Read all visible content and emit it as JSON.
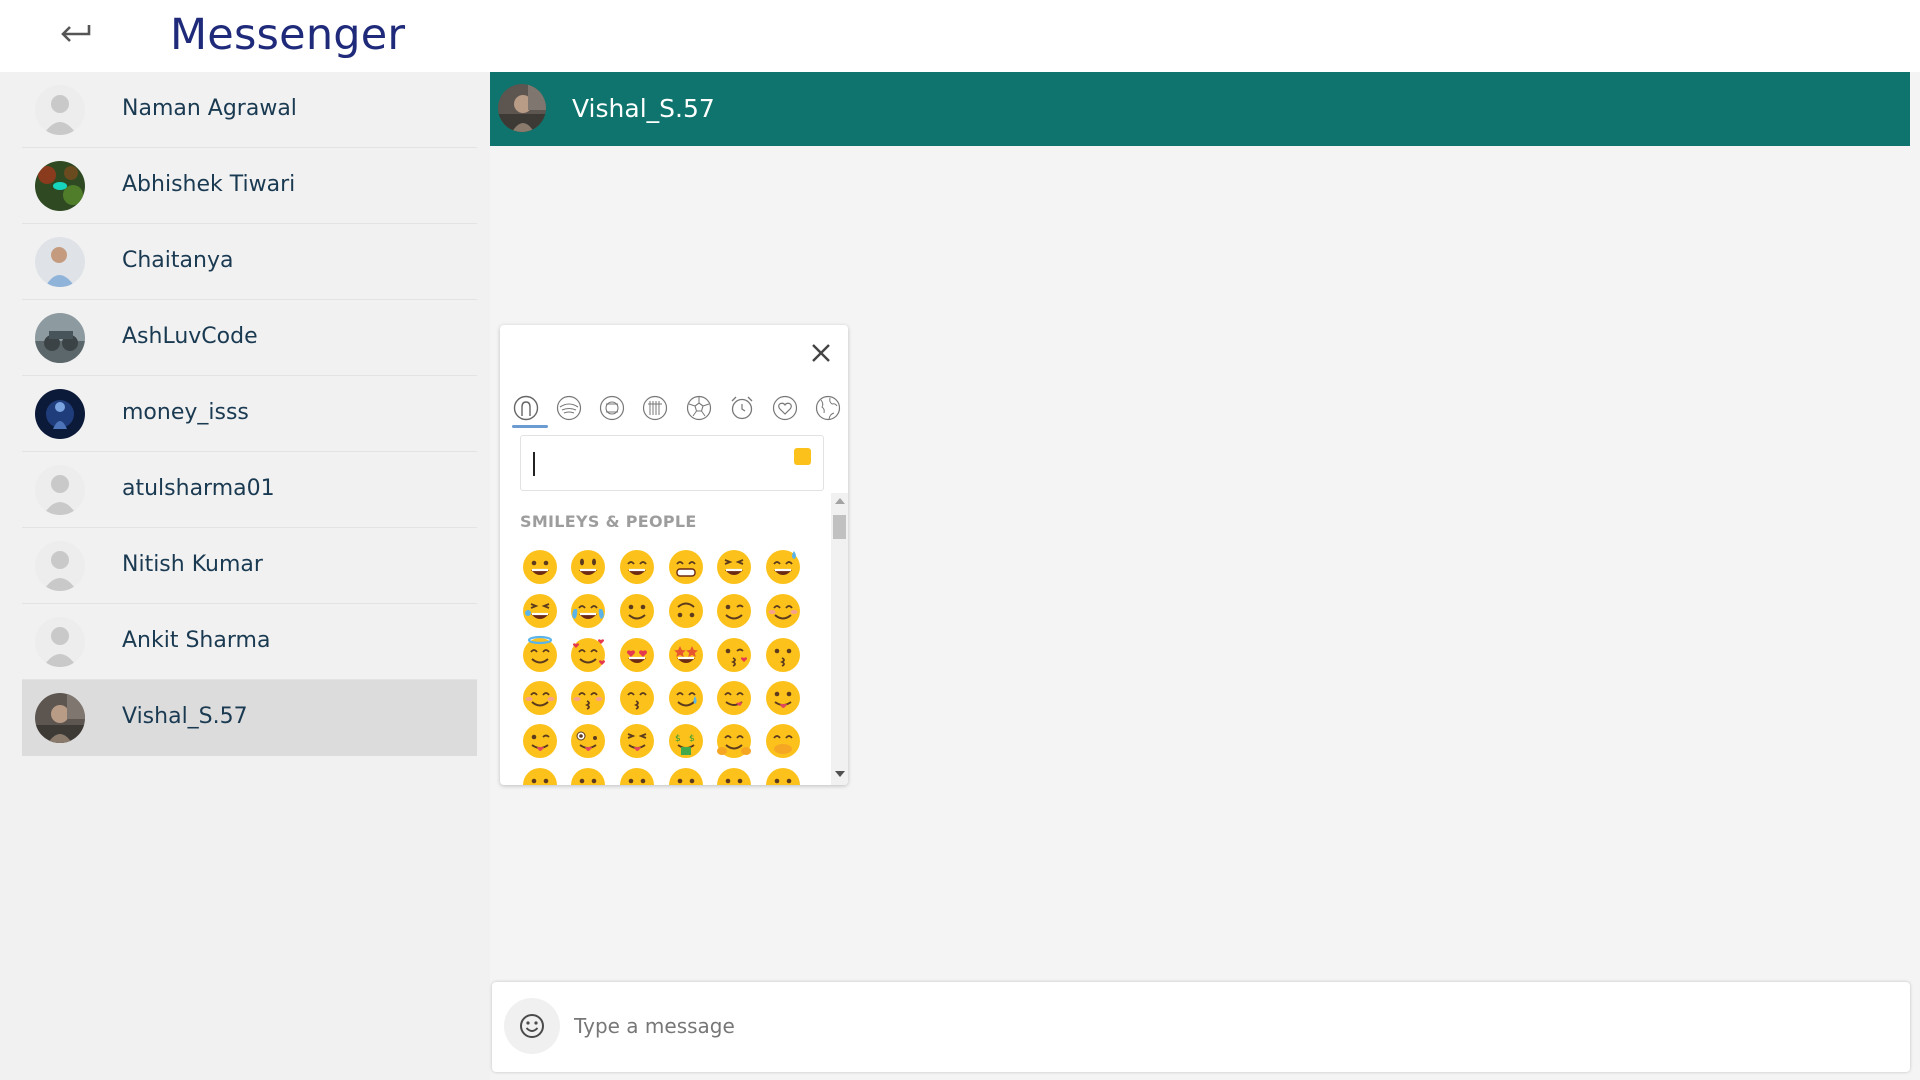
{
  "app": {
    "title": "Messenger",
    "back_icon": "back-arrow-icon"
  },
  "contacts": [
    {
      "name": "Naman Agrawal",
      "avatar": "default-avatar"
    },
    {
      "name": "Abhishek Tiwari",
      "avatar": "photo-green"
    },
    {
      "name": "Chaitanya",
      "avatar": "photo-person"
    },
    {
      "name": "AshLuvCode",
      "avatar": "photo-grey"
    },
    {
      "name": "money_isss",
      "avatar": "photo-dark-blue"
    },
    {
      "name": "atulsharma01",
      "avatar": "default-avatar"
    },
    {
      "name": "Nitish Kumar",
      "avatar": "default-avatar"
    },
    {
      "name": "Ankit Sharma",
      "avatar": "default-avatar"
    },
    {
      "name": "Vishal_S.57",
      "avatar": "photo-person-dark",
      "active": true
    }
  ],
  "chat": {
    "contact_name": "Vishal_S.57",
    "header_color": "#0e746d"
  },
  "emoji_picker": {
    "close_icon": "close-icon",
    "categories": [
      "smileys-people",
      "animals-nature",
      "food-drink",
      "travel-places",
      "activities",
      "objects",
      "symbols",
      "flags"
    ],
    "active_category": "smileys-people",
    "search_value": "",
    "skin_tone_color": "#fcc21b",
    "section_label": "SMILEYS & PEOPLE",
    "emojis": [
      [
        "grinning-face",
        "smiling-face-open-mouth",
        "smiling-face-smiling-eyes",
        "beaming-face",
        "grinning-squinting-face",
        "grinning-face-sweat"
      ],
      [
        "rolling-on-floor-laughing",
        "tears-of-joy",
        "slightly-smiling-face",
        "upside-down-face",
        "winking-face",
        "smiling-face-blush"
      ],
      [
        "smiling-face-halo",
        "smiling-face-hearts",
        "heart-eyes",
        "star-struck",
        "face-blowing-kiss",
        "kissing-face"
      ],
      [
        "smiling-face",
        "kissing-face-closed-eyes",
        "kissing-face-smiling-eyes",
        "smiling-face-tear",
        "face-savoring-food",
        "face-with-tongue"
      ],
      [
        "winking-face-tongue",
        "zany-face",
        "squinting-face-tongue",
        "money-mouth-face",
        "hugging-face",
        "face-hand-over-mouth"
      ],
      [
        "shushing-face",
        "thinking-face",
        "zipper-mouth-face",
        "face-raised-eyebrow",
        "neutral-face",
        "expressionless-face"
      ]
    ]
  },
  "composer": {
    "placeholder": "Type a message",
    "value": "",
    "emoji_icon": "smiley-icon"
  }
}
